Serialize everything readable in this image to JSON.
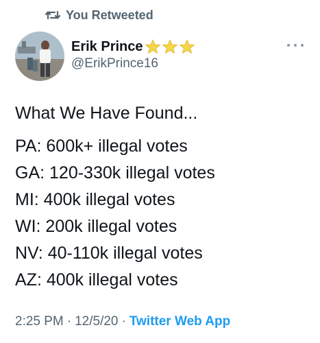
{
  "retweet": {
    "label": "You Retweeted",
    "icon": "retweet-icon"
  },
  "author": {
    "name": "Erik Prince",
    "handle": "@ErikPrince16",
    "badges": [
      "star-icon",
      "star-icon",
      "star-icon"
    ],
    "avatar_icon": "profile-photo"
  },
  "menu": {
    "icon": "more-icon"
  },
  "tweet": {
    "intro": "What We Have Found...",
    "lines": [
      "PA: 600k+ illegal votes",
      "GA: 120-330k illegal votes",
      "MI: 400k illegal votes",
      "WI: 200k illegal votes",
      "NV: 40-110k illegal votes",
      "AZ: 400k illegal votes"
    ]
  },
  "meta": {
    "time": "2:25 PM",
    "date": "12/5/20",
    "separator": "·",
    "source": "Twitter Web App"
  },
  "colors": {
    "text": "#0f1419",
    "secondary": "#536471",
    "link": "#1d9bf0",
    "star": "#f5d84a"
  }
}
